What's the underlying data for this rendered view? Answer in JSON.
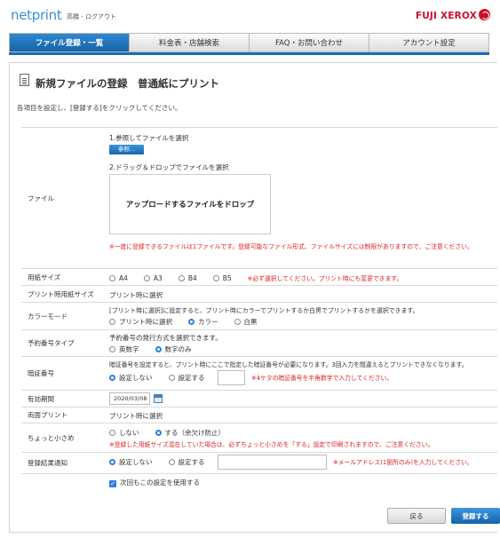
{
  "header": {
    "logo": "netprint",
    "user_name": "高橋",
    "separator": " - ",
    "logout": "ログアウト",
    "brand": "FUJI XEROX"
  },
  "nav": {
    "tabs": [
      "ファイル登録・一覧",
      "料金表・店舗検索",
      "FAQ・お問い合わせ",
      "アカウント設定"
    ]
  },
  "page": {
    "title": "新規ファイルの登録　普通紙にプリント",
    "instruction": "各項目を設定し、[登録する]をクリックしてください。"
  },
  "form": {
    "file": {
      "label": "ファイル",
      "step1": "1.参照してファイルを選択",
      "browse_button": "参照...",
      "step2": "2.ドラッグ＆ドロップでファイルを選択",
      "dropzone": "アップロードするファイルをドロップ",
      "note": "※一度に登録できるファイルは1ファイルです。登録可能なファイル形式、ファイルサイズには制限がありますので、ご注意ください。"
    },
    "paper_size": {
      "label": "用紙サイズ",
      "options": [
        "A4",
        "A3",
        "B4",
        "B5"
      ],
      "note": "※必ず選択してください。プリント時にも変更できます。"
    },
    "print_paper_size": {
      "label": "プリント時用紙サイズ",
      "value": "プリント時に選択"
    },
    "color_mode": {
      "label": "カラーモード",
      "description": "[プリント時に選択]に設定すると、プリント時にカラーでプリントするか白黒でプリントするかを選択できます。",
      "options": [
        "プリント時に選択",
        "カラー",
        "白黒"
      ],
      "selected": 1
    },
    "reservation_type": {
      "label": "予約番号タイプ",
      "description": "予約番号の発行方式を選択できます。",
      "options": [
        "英数字",
        "数字のみ"
      ],
      "selected": 1
    },
    "pin": {
      "label": "暗証番号",
      "description": "暗証番号を設定すると、プリント時にここで指定した暗証番号が必要になります。3回入力を間違えるとプリントできなくなります。",
      "options": [
        "設定しない",
        "設定する"
      ],
      "selected": 0,
      "value": "",
      "note": "※4ケタの暗証番号を半角数字で入力してください。"
    },
    "expiry": {
      "label": "有効期間",
      "value": "2020/03/08"
    },
    "duplex": {
      "label": "両面プリント",
      "value": "プリント時に選択"
    },
    "shrink": {
      "label": "ちょっと小さめ",
      "options": [
        "しない",
        "する（余欠け防止）"
      ],
      "selected": 1,
      "note": "※登録した用紙サイズ混在していた場合は、必ずちょっと小さめを「する」設定で印刷されますので、ご注意ください。"
    },
    "notify": {
      "label": "登録結果通知",
      "options": [
        "設定しない",
        "設定する"
      ],
      "selected": 0,
      "value": "",
      "note": "※メールアドレス(1箇所のみ)を入力してください。"
    },
    "reuse": {
      "label": "次回もこの設定を使用する",
      "checked": true
    }
  },
  "buttons": {
    "back": "戻る",
    "submit": "登録する"
  }
}
